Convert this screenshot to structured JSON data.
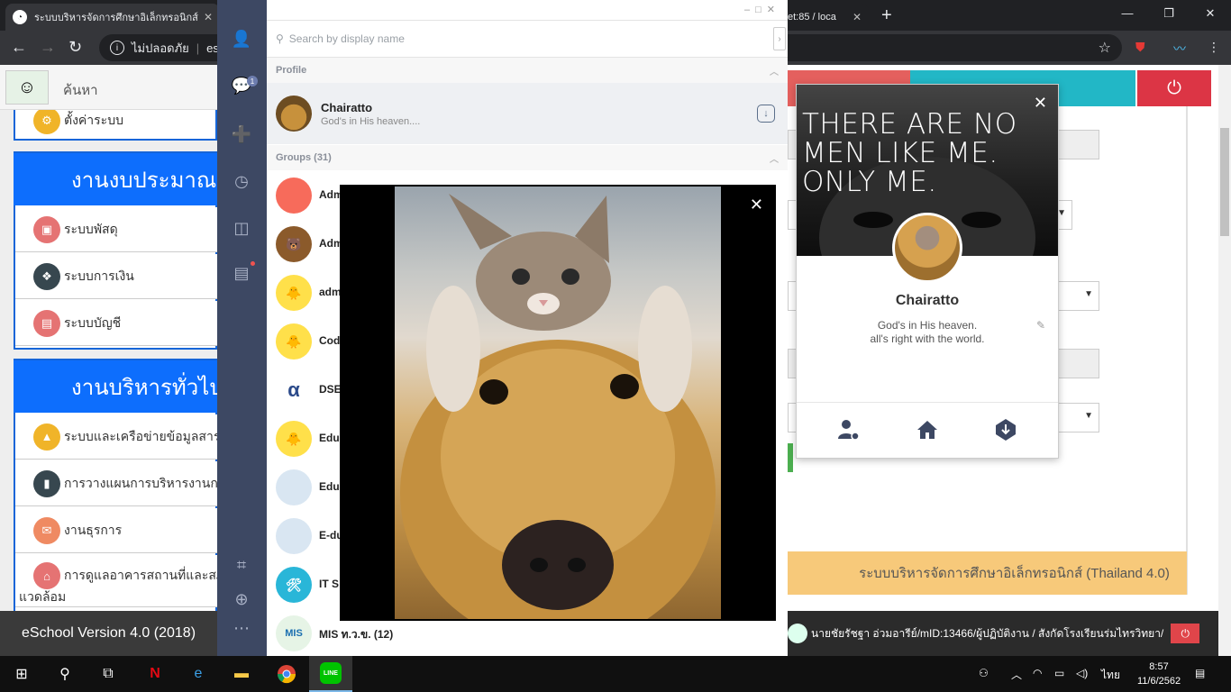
{
  "browser": {
    "active_tab_title": "ระบบบริหารจัดการศึกษาอิเล็กทรอนิกส์",
    "right_tab_title": "et:85 / loca",
    "address_security": "ไม่ปลอดภัย",
    "address_url": "esc"
  },
  "eschool": {
    "search_placeholder": "ค้นหา",
    "top_item": "ตั้งค่าระบบ",
    "section1_title": "งานงบประมาณ",
    "section1_items": [
      "ระบบพัสดุ",
      "ระบบการเงิน",
      "ระบบบัญชี"
    ],
    "section2_title": "งานบริหารทั่วไป",
    "section2_items": [
      "ระบบและเครือข่ายข้อมูลสารสนเทศ",
      "การวางแผนการบริหารงานการ",
      "งานธุรการ",
      "การดูแลอาคารสถานที่และสภาพ"
    ],
    "section2_item4_line2": "แวดล้อม",
    "footer_version": "eSchool Version 4.0 (2018)",
    "banner": "ระบบบริหารจัดการศึกษาอิเล็กทรอนิกส์ (Thailand 4.0)",
    "user_status": "นายชัยรัชฐา อ่วมอารีย์/mID:13466/ผู้ปฏิบัติงาน / สังกัดโรงเรียนร่มไทรวิทยา/"
  },
  "line": {
    "search_placeholder": "Search by display name",
    "profile_header": "Profile",
    "profile_name": "Chairatto",
    "profile_status_short": "God's in His heaven....",
    "groups_header": "Groups (31)",
    "groups": [
      {
        "name": "Adm",
        "color": "#f76b5b",
        "glyph": ""
      },
      {
        "name": "Adm",
        "color": "#8b5a2b",
        "glyph": "🐻"
      },
      {
        "name": "adm",
        "color": "#ffe04a",
        "glyph": "🐥"
      },
      {
        "name": "Cod",
        "color": "#ffe04a",
        "glyph": "🐥"
      },
      {
        "name": "DSE",
        "color": "#ffffff",
        "glyph": "α"
      },
      {
        "name": "Edu",
        "color": "#ffe04a",
        "glyph": "🐥"
      },
      {
        "name": "Edu",
        "color": "#d9e6f2",
        "glyph": ""
      },
      {
        "name": "E-du",
        "color": "#d9e6f2",
        "glyph": ""
      },
      {
        "name": "IT S",
        "color": "#29b6d8",
        "glyph": "🛠"
      },
      {
        "name": "MIS ท.ว.ข. (12)",
        "color": "#e6f4e6",
        "glyph": "MIS"
      }
    ],
    "unread_badge": "1"
  },
  "profile_card": {
    "cover_text": "THERE ARE NO MEN LIKE ME. ONLY ME.",
    "name": "Chairatto",
    "status_line1": "God's in His heaven.",
    "status_line2": "all's right with the world."
  },
  "taskbar": {
    "lang": "ไทย",
    "time": "8:57",
    "date": "11/6/2562"
  },
  "icons": {
    "close": "close-icon",
    "search": "search-icon",
    "download": "download-icon",
    "home": "home-icon",
    "settings": "user-settings-icon"
  }
}
